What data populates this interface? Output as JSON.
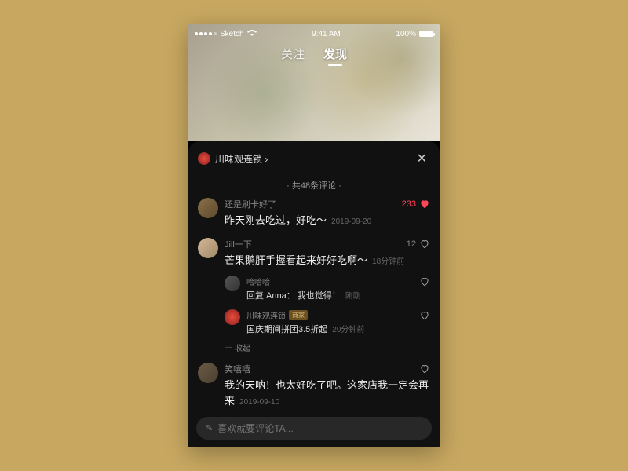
{
  "status": {
    "carrier": "Sketch",
    "time": "9:41 AM",
    "battery": "100%"
  },
  "tabs": {
    "follow": "关注",
    "discover": "发现"
  },
  "panel": {
    "shop_name": "川味观连锁",
    "count_label": "· 共48条评论 ·"
  },
  "comments": [
    {
      "username": "还是刷卡好了",
      "text": "昨天刚去吃过，好吃～",
      "timestamp": "2019-09-20",
      "likes": "233",
      "liked": true,
      "replies": []
    },
    {
      "username": "Jill一下",
      "text": "芒果鹅肝手握看起来好好吃啊～",
      "timestamp": "18分钟前",
      "likes": "12",
      "liked": false,
      "replies": [
        {
          "username": "哈哈哈",
          "text": "回复 Anna： 我也觉得！",
          "timestamp": "刚刚",
          "badge": ""
        },
        {
          "username": "川味观连锁",
          "text": "国庆期间拼团3.5折起",
          "timestamp": "20分钟前",
          "badge": "商家"
        }
      ],
      "collapse_label": "收起"
    },
    {
      "username": "笑嘻嘻",
      "text": "我的天呐！也太好吃了吧。这家店我一定会再来",
      "timestamp": "2019-09-10",
      "likes": "",
      "liked": false,
      "replies": []
    }
  ],
  "input": {
    "placeholder": "喜欢就要评论TA..."
  }
}
